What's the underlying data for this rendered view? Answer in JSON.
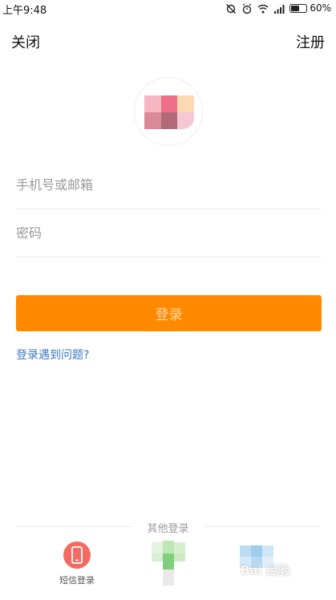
{
  "status_bar": {
    "time": "上午9:48",
    "battery_percent": "60%",
    "battery_level": 0.6,
    "icons": [
      "alarm-off-icon",
      "alarm-clock-icon",
      "wifi-icon",
      "signal-icon",
      "battery-icon"
    ]
  },
  "header": {
    "close_label": "关闭",
    "register_label": "注册"
  },
  "avatar": {
    "icon": "pixelated-avatar"
  },
  "form": {
    "phone_placeholder": "手机号或邮箱",
    "password_placeholder": "密码",
    "login_label": "登录",
    "help_link": "登录遇到问题?"
  },
  "other_login": {
    "label": "其他登录",
    "sms_label": "短信登录"
  },
  "colors": {
    "accent": "#ff8a00",
    "link": "#3b79c2",
    "sms": "#f36b62"
  },
  "watermark": "Bai 经验"
}
